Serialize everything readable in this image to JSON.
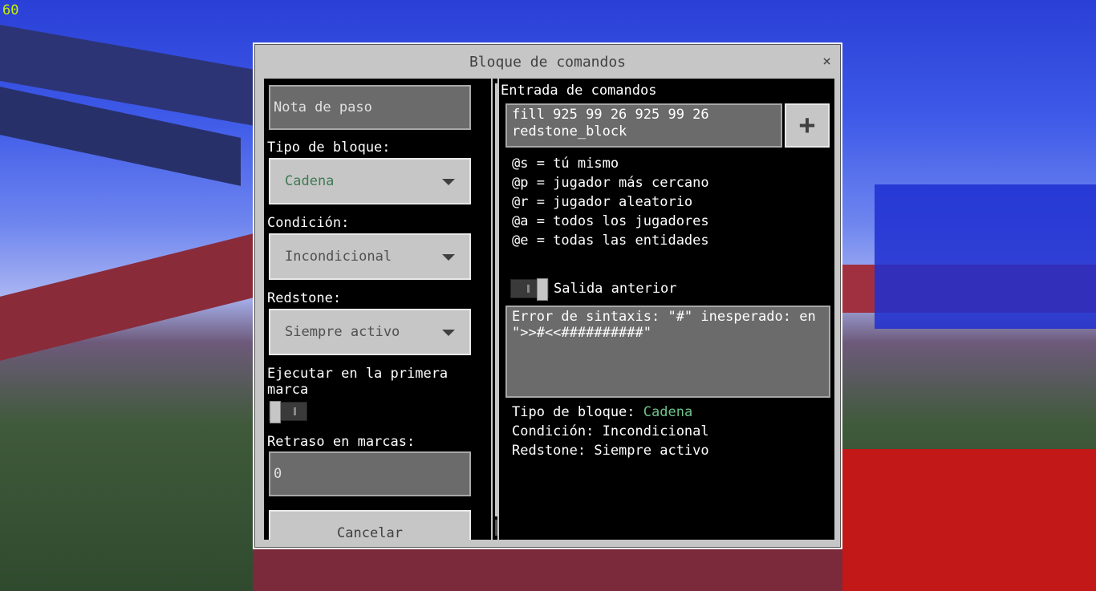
{
  "hud": {
    "fps": "60"
  },
  "dialog": {
    "title": "Bloque de comandos",
    "close": "×"
  },
  "left": {
    "step_note_placeholder": "Nota de paso",
    "block_type_label": "Tipo de bloque:",
    "block_type_value": "Cadena",
    "condition_label": "Condición:",
    "condition_value": "Incondicional",
    "redstone_label": "Redstone:",
    "redstone_value": "Siempre activo",
    "first_tick_label_1": "Ejecutar en la primera",
    "first_tick_label_2": "marca",
    "delay_label": "Retraso en marcas:",
    "delay_value": "0",
    "cancel_label": "Cancelar"
  },
  "right": {
    "command_input_label": "Entrada de comandos",
    "command_line_1": "fill 925 99 26 925 99 26",
    "command_line_2": "redstone_block",
    "plus_label": "+",
    "hints": [
      "@s = tú mismo",
      "@p = jugador más cercano",
      "@r = jugador aleatorio",
      "@a = todos los jugadores",
      "@e = todas las entidades"
    ],
    "previous_output_label": "Salida anterior",
    "error_line_1": "Error de sintaxis: \"#\" inesperado: en",
    "error_line_2": "\">>#<<##########\"",
    "info_block_type_label": "Tipo de bloque: ",
    "info_block_type_value": "Cadena",
    "info_condition": "Condición: Incondicional",
    "info_redstone": "Redstone: Siempre activo"
  }
}
